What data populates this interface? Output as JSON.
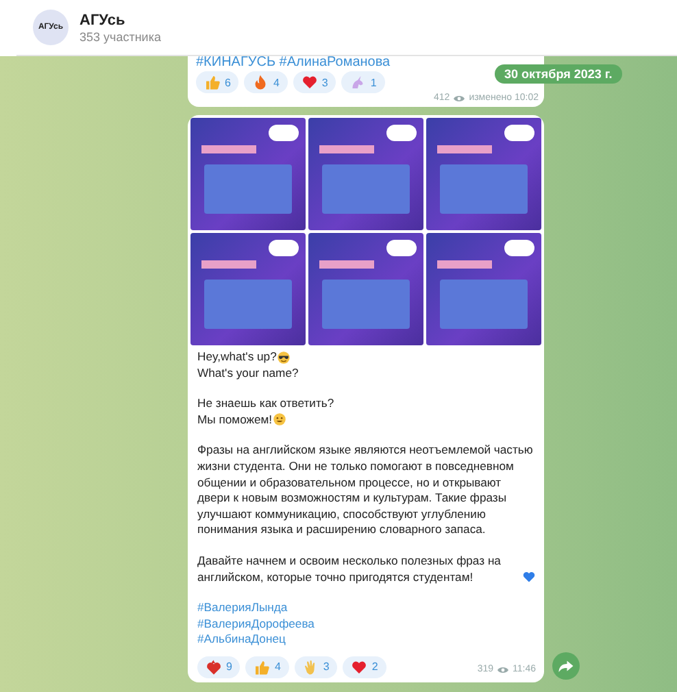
{
  "header": {
    "title": "АГУсь",
    "subtitle": "353 участника",
    "avatar_text": "АГУсь"
  },
  "prev_message": {
    "hashtags": "#КИНАГУСЬ #АлинаРоманова",
    "reactions": [
      {
        "kind": "thumbs",
        "count": "6"
      },
      {
        "kind": "fire",
        "count": "4"
      },
      {
        "kind": "heart",
        "count": "3"
      },
      {
        "kind": "unicorn",
        "count": "1"
      }
    ],
    "views": "412",
    "time": "изменено 10:02"
  },
  "date_pill": "30 октября 2023 г.",
  "message": {
    "paragraphs": [
      {
        "lines": [
          {
            "text": "Hey,what's up?"
          },
          {
            "text": "What's your name?"
          }
        ]
      },
      {
        "lines": [
          {
            "text": "Не знаешь как ответить?"
          },
          {
            "text": "Мы поможем!"
          }
        ]
      },
      {
        "lines": [
          {
            "text": "Фразы на английском языке являются неотъемлемой частью жизни студента. Они не только помогают в повседневном общении и образовательном процессе, но и открывают двери к новым возможностям и культурам. Такие фразы улучшают коммуникацию, способствуют углублению понимания языка и расширению словарного запаса."
          }
        ]
      },
      {
        "lines": [
          {
            "text": "Давайте начнем и освоим несколько полезных фраз на английском, которые точно пригодятся студентам!"
          }
        ]
      }
    ],
    "hashtags": [
      "#ВалерияЛында",
      "#ВалерияДорофеева",
      "#АльбинаДонец"
    ],
    "reactions": [
      {
        "kind": "heartfire",
        "count": "9"
      },
      {
        "kind": "thumbs",
        "count": "4"
      },
      {
        "kind": "clap",
        "count": "3"
      },
      {
        "kind": "heart",
        "count": "2"
      }
    ],
    "views": "319",
    "time": "11:46"
  }
}
